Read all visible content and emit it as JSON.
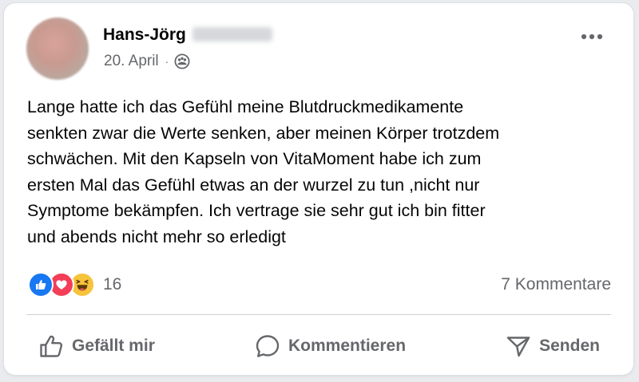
{
  "post": {
    "author_name": "Hans-Jörg",
    "date": "20. April",
    "meta_separator": "·",
    "audience_icon": "friends-icon",
    "more_icon": "more-options-icon",
    "text": "Lange hatte ich das Gefühl meine Blutdruckmedikamente\nsenkten zwar die Werte senken, aber meinen Körper trotzdem\nschwächen. Mit den Kapseln von VitaMoment habe ich zum\nersten Mal das Gefühl etwas an der wurzel zu tun ,nicht nur\nSymptome  bekämpfen. Ich vertrage sie sehr gut ich bin fitter\nund abends nicht mehr so erledigt"
  },
  "reactions": {
    "icons": [
      "like-reaction-icon",
      "love-reaction-icon",
      "haha-reaction-icon"
    ],
    "count": "16",
    "comments": "7 Kommentare"
  },
  "actions": {
    "like_label": "Gefällt mir",
    "comment_label": "Kommentieren",
    "share_label": "Senden"
  },
  "colors": {
    "like_blue": "#1877f2",
    "love_red": "#f33e58",
    "haha_yellow": "#f7c33b",
    "secondary_text": "#65676b",
    "primary_text": "#050505"
  }
}
